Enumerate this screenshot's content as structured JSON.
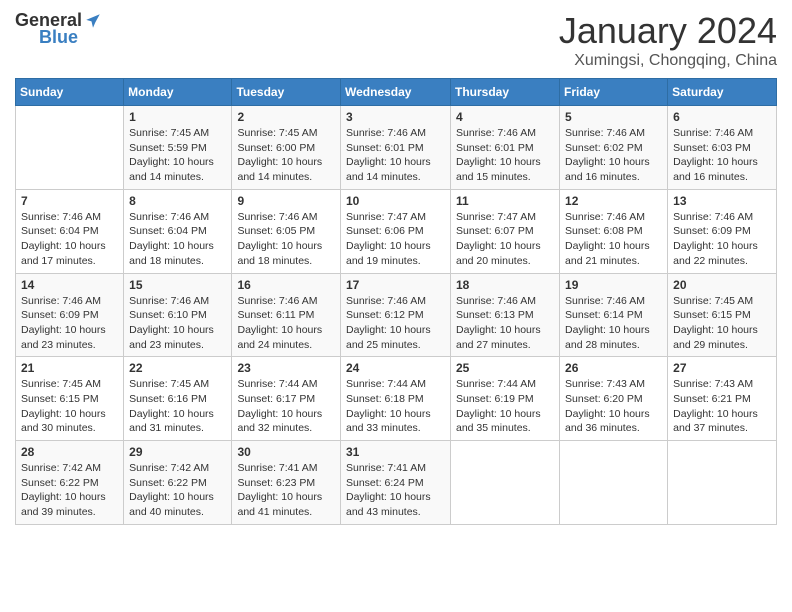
{
  "header": {
    "logo_general": "General",
    "logo_blue": "Blue",
    "month_title": "January 2024",
    "location": "Xumingsi, Chongqing, China"
  },
  "days_of_week": [
    "Sunday",
    "Monday",
    "Tuesday",
    "Wednesday",
    "Thursday",
    "Friday",
    "Saturday"
  ],
  "weeks": [
    [
      {
        "day": "",
        "info": ""
      },
      {
        "day": "1",
        "info": "Sunrise: 7:45 AM\nSunset: 5:59 PM\nDaylight: 10 hours\nand 14 minutes."
      },
      {
        "day": "2",
        "info": "Sunrise: 7:45 AM\nSunset: 6:00 PM\nDaylight: 10 hours\nand 14 minutes."
      },
      {
        "day": "3",
        "info": "Sunrise: 7:46 AM\nSunset: 6:01 PM\nDaylight: 10 hours\nand 14 minutes."
      },
      {
        "day": "4",
        "info": "Sunrise: 7:46 AM\nSunset: 6:01 PM\nDaylight: 10 hours\nand 15 minutes."
      },
      {
        "day": "5",
        "info": "Sunrise: 7:46 AM\nSunset: 6:02 PM\nDaylight: 10 hours\nand 16 minutes."
      },
      {
        "day": "6",
        "info": "Sunrise: 7:46 AM\nSunset: 6:03 PM\nDaylight: 10 hours\nand 16 minutes."
      }
    ],
    [
      {
        "day": "7",
        "info": "Sunrise: 7:46 AM\nSunset: 6:04 PM\nDaylight: 10 hours\nand 17 minutes."
      },
      {
        "day": "8",
        "info": "Sunrise: 7:46 AM\nSunset: 6:04 PM\nDaylight: 10 hours\nand 18 minutes."
      },
      {
        "day": "9",
        "info": "Sunrise: 7:46 AM\nSunset: 6:05 PM\nDaylight: 10 hours\nand 18 minutes."
      },
      {
        "day": "10",
        "info": "Sunrise: 7:47 AM\nSunset: 6:06 PM\nDaylight: 10 hours\nand 19 minutes."
      },
      {
        "day": "11",
        "info": "Sunrise: 7:47 AM\nSunset: 6:07 PM\nDaylight: 10 hours\nand 20 minutes."
      },
      {
        "day": "12",
        "info": "Sunrise: 7:46 AM\nSunset: 6:08 PM\nDaylight: 10 hours\nand 21 minutes."
      },
      {
        "day": "13",
        "info": "Sunrise: 7:46 AM\nSunset: 6:09 PM\nDaylight: 10 hours\nand 22 minutes."
      }
    ],
    [
      {
        "day": "14",
        "info": "Sunrise: 7:46 AM\nSunset: 6:09 PM\nDaylight: 10 hours\nand 23 minutes."
      },
      {
        "day": "15",
        "info": "Sunrise: 7:46 AM\nSunset: 6:10 PM\nDaylight: 10 hours\nand 23 minutes."
      },
      {
        "day": "16",
        "info": "Sunrise: 7:46 AM\nSunset: 6:11 PM\nDaylight: 10 hours\nand 24 minutes."
      },
      {
        "day": "17",
        "info": "Sunrise: 7:46 AM\nSunset: 6:12 PM\nDaylight: 10 hours\nand 25 minutes."
      },
      {
        "day": "18",
        "info": "Sunrise: 7:46 AM\nSunset: 6:13 PM\nDaylight: 10 hours\nand 27 minutes."
      },
      {
        "day": "19",
        "info": "Sunrise: 7:46 AM\nSunset: 6:14 PM\nDaylight: 10 hours\nand 28 minutes."
      },
      {
        "day": "20",
        "info": "Sunrise: 7:45 AM\nSunset: 6:15 PM\nDaylight: 10 hours\nand 29 minutes."
      }
    ],
    [
      {
        "day": "21",
        "info": "Sunrise: 7:45 AM\nSunset: 6:15 PM\nDaylight: 10 hours\nand 30 minutes."
      },
      {
        "day": "22",
        "info": "Sunrise: 7:45 AM\nSunset: 6:16 PM\nDaylight: 10 hours\nand 31 minutes."
      },
      {
        "day": "23",
        "info": "Sunrise: 7:44 AM\nSunset: 6:17 PM\nDaylight: 10 hours\nand 32 minutes."
      },
      {
        "day": "24",
        "info": "Sunrise: 7:44 AM\nSunset: 6:18 PM\nDaylight: 10 hours\nand 33 minutes."
      },
      {
        "day": "25",
        "info": "Sunrise: 7:44 AM\nSunset: 6:19 PM\nDaylight: 10 hours\nand 35 minutes."
      },
      {
        "day": "26",
        "info": "Sunrise: 7:43 AM\nSunset: 6:20 PM\nDaylight: 10 hours\nand 36 minutes."
      },
      {
        "day": "27",
        "info": "Sunrise: 7:43 AM\nSunset: 6:21 PM\nDaylight: 10 hours\nand 37 minutes."
      }
    ],
    [
      {
        "day": "28",
        "info": "Sunrise: 7:42 AM\nSunset: 6:22 PM\nDaylight: 10 hours\nand 39 minutes."
      },
      {
        "day": "29",
        "info": "Sunrise: 7:42 AM\nSunset: 6:22 PM\nDaylight: 10 hours\nand 40 minutes."
      },
      {
        "day": "30",
        "info": "Sunrise: 7:41 AM\nSunset: 6:23 PM\nDaylight: 10 hours\nand 41 minutes."
      },
      {
        "day": "31",
        "info": "Sunrise: 7:41 AM\nSunset: 6:24 PM\nDaylight: 10 hours\nand 43 minutes."
      },
      {
        "day": "",
        "info": ""
      },
      {
        "day": "",
        "info": ""
      },
      {
        "day": "",
        "info": ""
      }
    ]
  ]
}
